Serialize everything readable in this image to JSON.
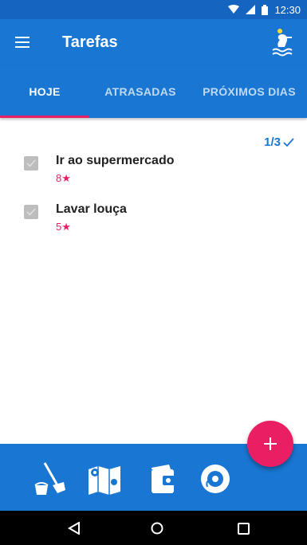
{
  "status_bar": {
    "time": "12:30",
    "icons": [
      "wifi-icon",
      "signal-icon",
      "battery-icon"
    ]
  },
  "app_bar": {
    "title": "Tarefas",
    "menu_icon": "hamburger-menu-icon",
    "logo_icon": "brand-logo-icon"
  },
  "tabs": [
    {
      "label": "HOJE",
      "active": true
    },
    {
      "label": "ATRASADAS",
      "active": false
    },
    {
      "label": "PRÓXIMOS DIAS",
      "active": false
    }
  ],
  "progress": {
    "text": "1/3",
    "completed": 1,
    "total": 3,
    "icon": "checkmark-icon"
  },
  "tasks": [
    {
      "title": "Ir ao supermercado",
      "points": "8★",
      "checked": false
    },
    {
      "title": "Lavar louça",
      "points": "5★",
      "checked": false
    }
  ],
  "bottom_nav": [
    {
      "icon": "cleaning-broom-icon"
    },
    {
      "icon": "map-icon"
    },
    {
      "icon": "wallet-icon"
    },
    {
      "icon": "music-disc-icon"
    }
  ],
  "fab": {
    "label": "+",
    "icon": "add-icon"
  },
  "system_nav": [
    {
      "icon": "back-icon"
    },
    {
      "icon": "home-icon"
    },
    {
      "icon": "recents-icon"
    }
  ],
  "colors": {
    "primary": "#1976d2",
    "status_bar": "#1565c0",
    "accent": "#e91e63",
    "checkbox": "#bdbdbd",
    "text": "#212121"
  }
}
